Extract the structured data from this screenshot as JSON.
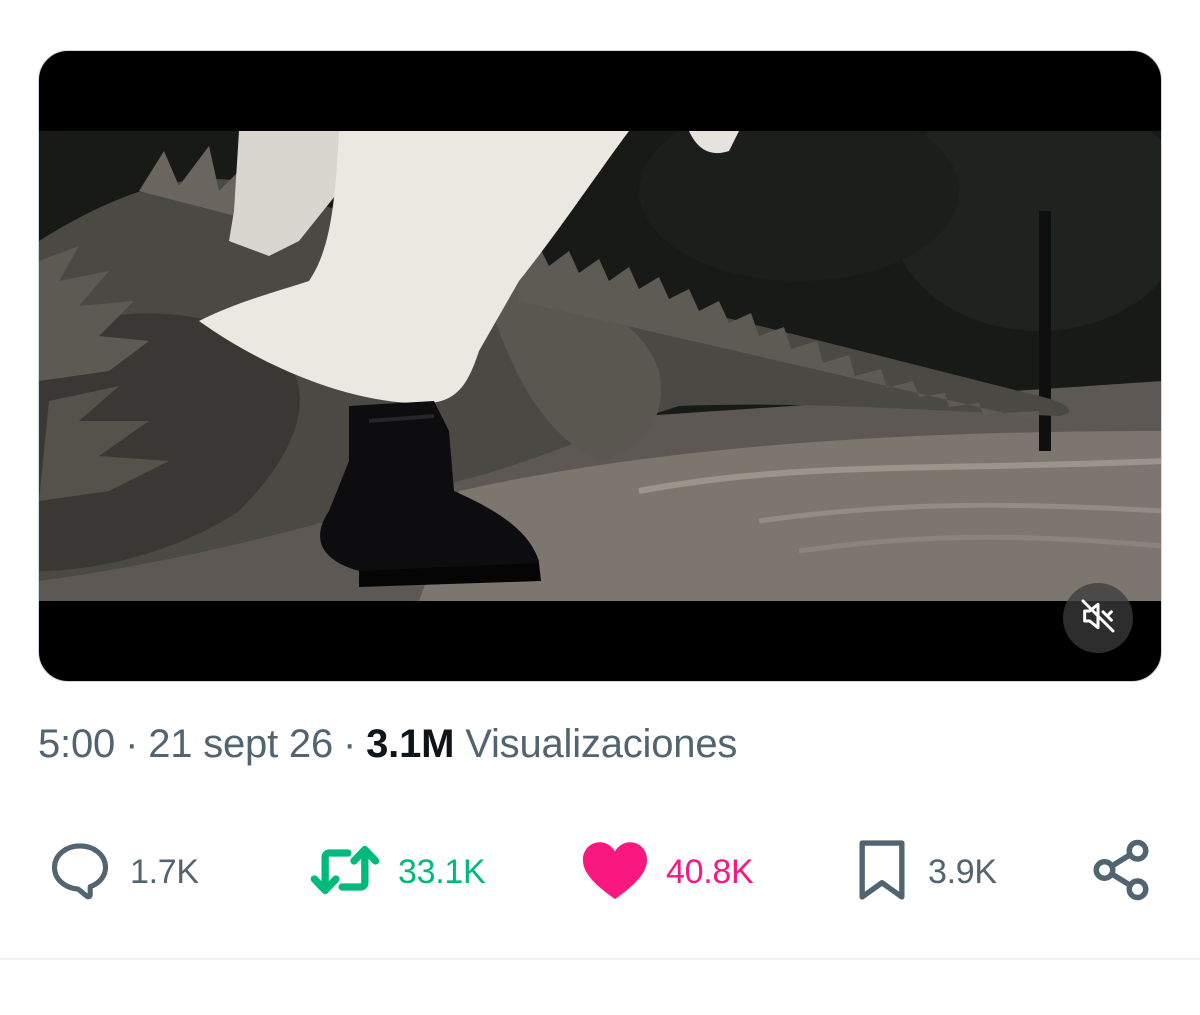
{
  "media": {
    "type": "video",
    "muted": true,
    "mute_icon": "speaker-muted-icon"
  },
  "meta": {
    "time": "5:00",
    "separator": "·",
    "date": "21 sept 26",
    "views_count": "3.1M",
    "views_label": "Visualizaciones"
  },
  "actions": {
    "reply": {
      "icon": "reply-bubble-icon",
      "count": "1.7K"
    },
    "retweet": {
      "icon": "retweet-icon",
      "count": "33.1K"
    },
    "like": {
      "icon": "heart-icon",
      "count": "40.8K",
      "liked": true
    },
    "bookmark": {
      "icon": "bookmark-icon",
      "count": "3.9K"
    },
    "share": {
      "icon": "share-icon"
    }
  },
  "colors": {
    "text_secondary": "#536471",
    "text_primary": "#0f1419",
    "retweet": "#00ba7c",
    "like": "#f91880",
    "divider": "#eff3f4"
  }
}
